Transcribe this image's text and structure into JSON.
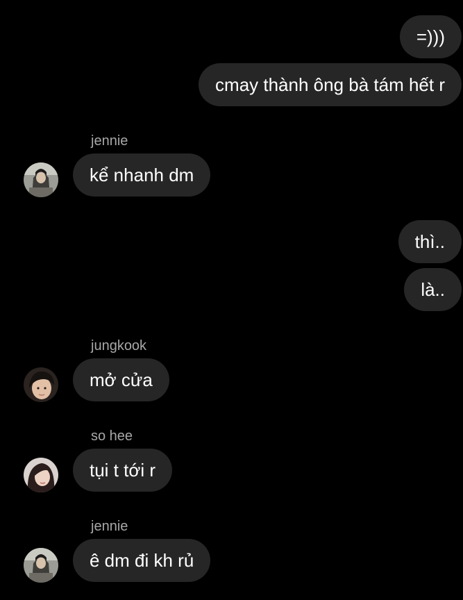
{
  "chat": {
    "messages": [
      {
        "side": "right",
        "text": "=)))"
      },
      {
        "side": "right",
        "text": "cmay thành ông bà tám hết r"
      },
      {
        "side": "left",
        "sender": "jennie",
        "text": "kể nhanh dm",
        "avatar_icon": "jennie-avatar-icon"
      },
      {
        "side": "right",
        "text": "thì.."
      },
      {
        "side": "right",
        "text": "là.."
      },
      {
        "side": "left",
        "sender": "jungkook",
        "text": "mở cửa",
        "avatar_icon": "jungkook-avatar-icon"
      },
      {
        "side": "left",
        "sender": "so hee",
        "text": "tụi t tới r",
        "avatar_icon": "sohee-avatar-icon"
      },
      {
        "side": "left",
        "sender": "jennie",
        "text": "ê dm đi kh rủ",
        "avatar_icon": "jennie-avatar-icon"
      }
    ]
  },
  "colors": {
    "background": "#000000",
    "bubble": "#262626",
    "sender_name": "#a8a8a8",
    "text": "#ffffff"
  }
}
